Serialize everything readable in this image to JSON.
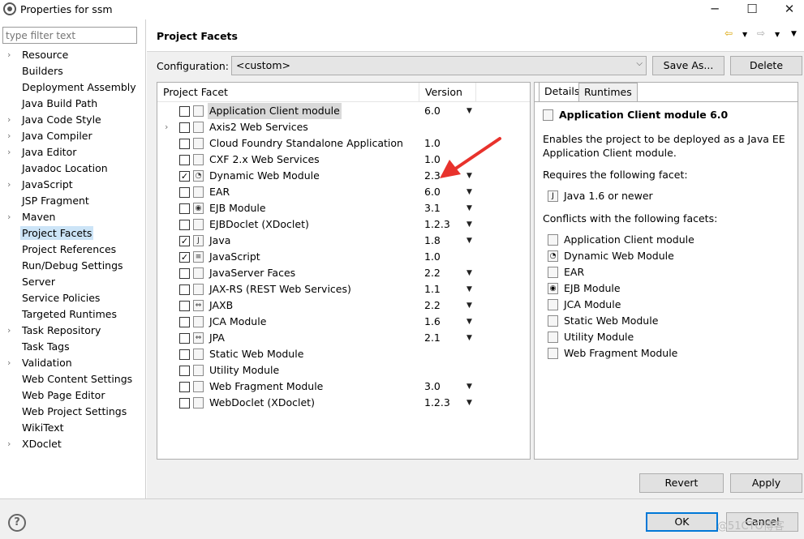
{
  "window": {
    "title": "Properties for ssm",
    "minimize": "─",
    "maximize": "☐",
    "close": "✕"
  },
  "filter": {
    "placeholder": "type filter text"
  },
  "nav": [
    {
      "label": "Resource",
      "expandable": true
    },
    {
      "label": "Builders",
      "expandable": false
    },
    {
      "label": "Deployment Assembly",
      "expandable": false
    },
    {
      "label": "Java Build Path",
      "expandable": false
    },
    {
      "label": "Java Code Style",
      "expandable": true
    },
    {
      "label": "Java Compiler",
      "expandable": true
    },
    {
      "label": "Java Editor",
      "expandable": true
    },
    {
      "label": "Javadoc Location",
      "expandable": false
    },
    {
      "label": "JavaScript",
      "expandable": true
    },
    {
      "label": "JSP Fragment",
      "expandable": false
    },
    {
      "label": "Maven",
      "expandable": true
    },
    {
      "label": "Project Facets",
      "expandable": false,
      "selected": true
    },
    {
      "label": "Project References",
      "expandable": false
    },
    {
      "label": "Run/Debug Settings",
      "expandable": false
    },
    {
      "label": "Server",
      "expandable": false
    },
    {
      "label": "Service Policies",
      "expandable": false
    },
    {
      "label": "Targeted Runtimes",
      "expandable": false
    },
    {
      "label": "Task Repository",
      "expandable": true
    },
    {
      "label": "Task Tags",
      "expandable": false
    },
    {
      "label": "Validation",
      "expandable": true
    },
    {
      "label": "Web Content Settings",
      "expandable": false
    },
    {
      "label": "Web Page Editor",
      "expandable": false
    },
    {
      "label": "Web Project Settings",
      "expandable": false
    },
    {
      "label": "WikiText",
      "expandable": false
    },
    {
      "label": "XDoclet",
      "expandable": true
    }
  ],
  "header": {
    "title": "Project Facets"
  },
  "config": {
    "label": "Configuration:",
    "value": "<custom>",
    "save_as": "Save As...",
    "delete": "Delete"
  },
  "table": {
    "col_facet": "Project Facet",
    "col_version": "Version",
    "rows": [
      {
        "name": "Application Client module",
        "version": "6.0",
        "checked": false,
        "dropdown": true,
        "selected": true,
        "icon": "page-icon"
      },
      {
        "name": "Axis2 Web Services",
        "version": "",
        "checked": false,
        "dropdown": false,
        "expand": true,
        "icon": "page-icon"
      },
      {
        "name": "Cloud Foundry Standalone Application",
        "version": "1.0",
        "checked": false,
        "dropdown": false,
        "icon": "page-icon"
      },
      {
        "name": "CXF 2.x Web Services",
        "version": "1.0",
        "checked": false,
        "dropdown": false,
        "icon": "page-icon"
      },
      {
        "name": "Dynamic Web Module",
        "version": "2.3",
        "checked": true,
        "dropdown": true,
        "icon": "web-module-icon"
      },
      {
        "name": "EAR",
        "version": "6.0",
        "checked": false,
        "dropdown": true,
        "icon": "page-icon"
      },
      {
        "name": "EJB Module",
        "version": "3.1",
        "checked": false,
        "dropdown": true,
        "icon": "ejb-icon"
      },
      {
        "name": "EJBDoclet (XDoclet)",
        "version": "1.2.3",
        "checked": false,
        "dropdown": true,
        "icon": "page-icon"
      },
      {
        "name": "Java",
        "version": "1.8",
        "checked": true,
        "dropdown": true,
        "icon": "java-icon"
      },
      {
        "name": "JavaScript",
        "version": "1.0",
        "checked": true,
        "dropdown": false,
        "icon": "javascript-icon"
      },
      {
        "name": "JavaServer Faces",
        "version": "2.2",
        "checked": false,
        "dropdown": true,
        "icon": "page-icon"
      },
      {
        "name": "JAX-RS (REST Web Services)",
        "version": "1.1",
        "checked": false,
        "dropdown": true,
        "icon": "page-icon"
      },
      {
        "name": "JAXB",
        "version": "2.2",
        "checked": false,
        "dropdown": true,
        "icon": "jaxb-icon"
      },
      {
        "name": "JCA Module",
        "version": "1.6",
        "checked": false,
        "dropdown": true,
        "icon": "page-icon"
      },
      {
        "name": "JPA",
        "version": "2.1",
        "checked": false,
        "dropdown": true,
        "icon": "jpa-icon"
      },
      {
        "name": "Static Web Module",
        "version": "",
        "checked": false,
        "dropdown": false,
        "icon": "page-icon"
      },
      {
        "name": "Utility Module",
        "version": "",
        "checked": false,
        "dropdown": false,
        "icon": "page-icon"
      },
      {
        "name": "Web Fragment Module",
        "version": "3.0",
        "checked": false,
        "dropdown": true,
        "icon": "page-icon"
      },
      {
        "name": "WebDoclet (XDoclet)",
        "version": "1.2.3",
        "checked": false,
        "dropdown": true,
        "icon": "page-icon"
      }
    ]
  },
  "details": {
    "tab_details": "Details",
    "tab_runtimes": "Runtimes",
    "title": "Application Client module 6.0",
    "description_1": "Enables the project to be deployed as a Java EE",
    "description_2": "Application Client module.",
    "requires_label": "Requires the following facet:",
    "requires": [
      {
        "name": "Java 1.6 or newer",
        "icon": "java-icon"
      }
    ],
    "conflicts_label": "Conflicts with the following facets:",
    "conflicts": [
      {
        "name": "Application Client module",
        "icon": "page-icon"
      },
      {
        "name": "Dynamic Web Module",
        "icon": "web-module-icon"
      },
      {
        "name": "EAR",
        "icon": "page-icon"
      },
      {
        "name": "EJB Module",
        "icon": "ejb-icon"
      },
      {
        "name": "JCA Module",
        "icon": "page-icon"
      },
      {
        "name": "Static Web Module",
        "icon": "page-icon"
      },
      {
        "name": "Utility Module",
        "icon": "page-icon"
      },
      {
        "name": "Web Fragment Module",
        "icon": "page-icon"
      }
    ]
  },
  "actions": {
    "revert": "Revert",
    "apply": "Apply",
    "ok": "OK",
    "cancel": "Cancel"
  },
  "watermark": "@51CTO博客",
  "colors": {
    "selection": "#cce4f7",
    "arrow": "#e8322c",
    "button_focus": "#0078d7"
  }
}
